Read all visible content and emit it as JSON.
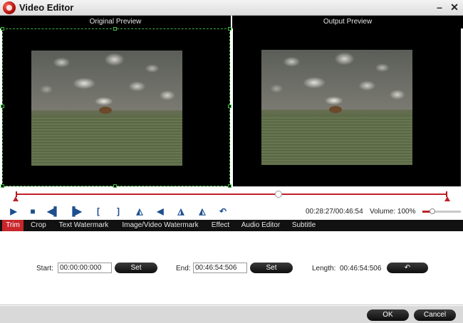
{
  "window": {
    "title": "Video Editor"
  },
  "preview": {
    "original_label": "Original Preview",
    "output_label": "Output Preview"
  },
  "playback": {
    "time": "00:28:27/00:46:54",
    "volume_label": "Volume:",
    "volume_value": "100%",
    "volume_level": 1.0,
    "position": 0.61
  },
  "controls": [
    {
      "name": "play-icon",
      "glyph": "▶"
    },
    {
      "name": "stop-icon",
      "glyph": "■"
    },
    {
      "name": "prev-frame-icon",
      "glyph": "◀▌"
    },
    {
      "name": "next-frame-icon",
      "glyph": "▐▶"
    },
    {
      "name": "mark-in-icon",
      "glyph": "["
    },
    {
      "name": "mark-out-icon",
      "glyph": "]"
    },
    {
      "name": "flip-horizontal-icon",
      "glyph": "◭"
    },
    {
      "name": "rotate-left-icon",
      "glyph": "◀"
    },
    {
      "name": "flip-vertical-icon",
      "glyph": "◮"
    },
    {
      "name": "rotate-right-icon",
      "glyph": "◭"
    },
    {
      "name": "undo-icon",
      "glyph": "↶"
    }
  ],
  "tabs": [
    "Trim",
    "Crop",
    "Text Watermark",
    "Image/Video Watermark",
    "Effect",
    "Audio Editor",
    "Subtitle"
  ],
  "active_tab": "Trim",
  "trim": {
    "start_label": "Start:",
    "start_value": "00:00:00:000",
    "end_label": "End:",
    "end_value": "00:46:54:506",
    "length_label": "Length:",
    "length_value": "00:46:54:506",
    "set_label": "Set"
  },
  "footer": {
    "ok_label": "OK",
    "cancel_label": "Cancel"
  },
  "colors": {
    "accent": "#c8262b",
    "crop_border": "#3fae3f",
    "icon": "#1d4f8f"
  }
}
